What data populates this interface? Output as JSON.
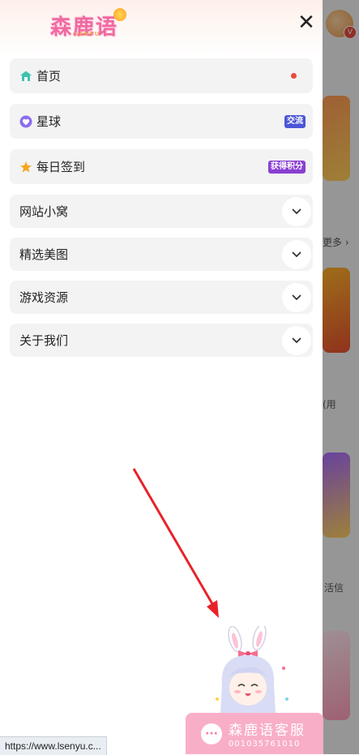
{
  "logo": {
    "text": "森鹿语",
    "sub": "SENYU"
  },
  "close_icon": "close-icon",
  "menu": {
    "top_items": [
      {
        "label": "首页",
        "icon": "home-icon",
        "indicator": "dot",
        "badge": ""
      },
      {
        "label": "星球",
        "icon": "planet-icon",
        "indicator": "badge",
        "badge": "交流"
      },
      {
        "label": "每日签到",
        "icon": "star-icon",
        "indicator": "badge",
        "badge": "获得积分"
      }
    ],
    "sub_items": [
      {
        "label": "网站小窝"
      },
      {
        "label": "精选美图"
      },
      {
        "label": "游戏资源"
      },
      {
        "label": "关于我们"
      }
    ]
  },
  "background": {
    "more": "更多 ›",
    "text1": "(用",
    "text2": "活信"
  },
  "service": {
    "title": "森鹿语客服",
    "number": "001035761010"
  },
  "status_url": "https://www.lsenyu.c...",
  "colors": {
    "accent_red": "#e74c3c",
    "badge_blue": "#4a56d6",
    "badge_purple": "#8a3fd1",
    "service_pink": "#f9aec8"
  }
}
